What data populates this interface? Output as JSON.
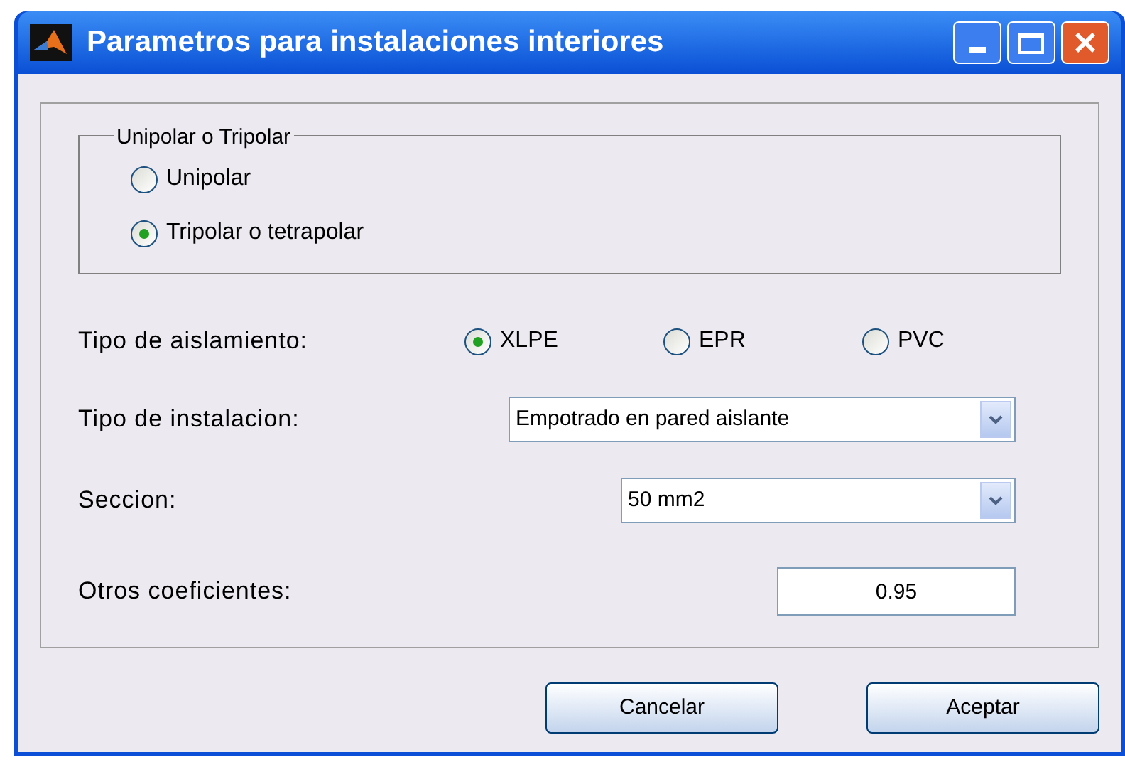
{
  "window": {
    "title": "Parametros para instalaciones interiores"
  },
  "group": {
    "title": "Unipolar o Tripolar",
    "options": [
      {
        "label": "Unipolar",
        "selected": false
      },
      {
        "label": "Tripolar o tetrapolar",
        "selected": true
      }
    ]
  },
  "insulation": {
    "label": "Tipo de aislamiento:",
    "options": [
      {
        "label": "XLPE",
        "selected": true
      },
      {
        "label": "EPR",
        "selected": false
      },
      {
        "label": "PVC",
        "selected": false
      }
    ]
  },
  "installation": {
    "label": "Tipo de instalacion:",
    "value": "Empotrado en pared aislante"
  },
  "section": {
    "label": "Seccion:",
    "value": "50 mm2"
  },
  "coefficients": {
    "label": "Otros coeficientes:",
    "value": "0.95"
  },
  "buttons": [
    "Cancelar",
    "Aceptar"
  ]
}
